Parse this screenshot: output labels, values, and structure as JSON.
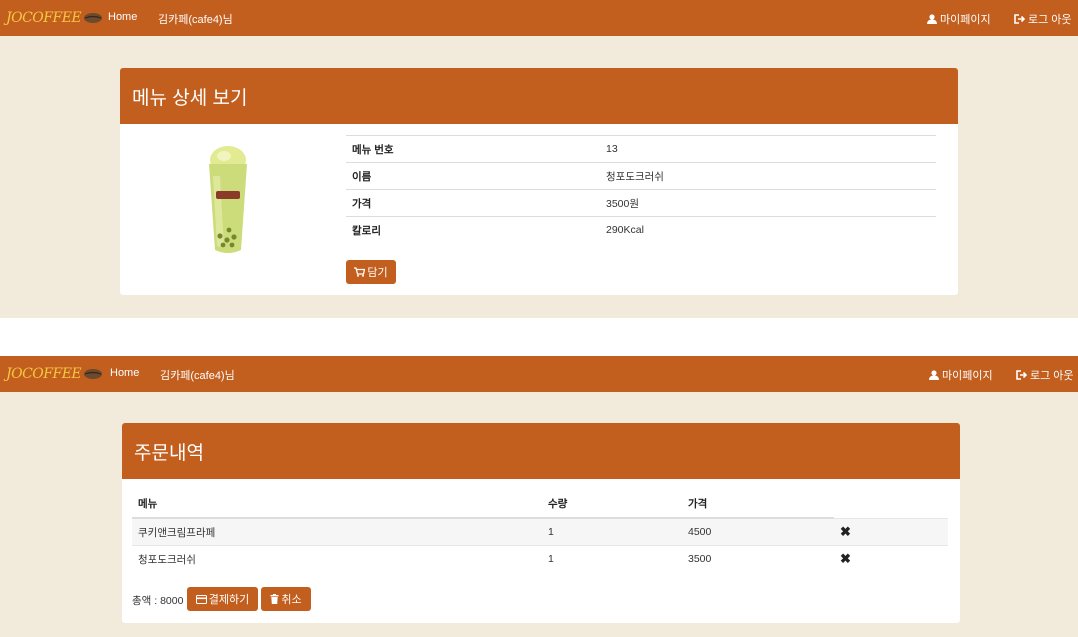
{
  "brand": {
    "logo_text": "JOCOFFEE"
  },
  "nav": {
    "home": "Home",
    "user_greeting": "김카페(cafe4)님",
    "mypage": "마이페이지",
    "logout": "로그 아웃"
  },
  "menu_detail": {
    "title": "메뉴 상세 보기",
    "rows": [
      {
        "label": "메뉴 번호",
        "value": "13"
      },
      {
        "label": "이름",
        "value": "청포도크러쉬"
      },
      {
        "label": "가격",
        "value": "3500원"
      },
      {
        "label": "칼로리",
        "value": "290Kcal"
      }
    ],
    "add_button": "담기"
  },
  "order_history": {
    "title": "주문내역",
    "headers": {
      "menu": "메뉴",
      "qty": "수량",
      "price": "가격"
    },
    "items": [
      {
        "menu": "쿠키앤크림프라페",
        "qty": "1",
        "price": "4500"
      },
      {
        "menu": "청포도크러쉬",
        "qty": "1",
        "price": "3500"
      }
    ],
    "total_label": "총액 : 8000",
    "pay_button": "결제하기",
    "cancel_button": "취소"
  },
  "colors": {
    "brand": "#c25e1e",
    "background": "#f2eadb",
    "logo": "#f5c842"
  }
}
